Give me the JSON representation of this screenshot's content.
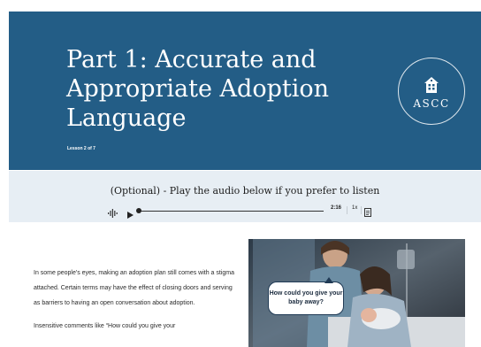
{
  "hero": {
    "title": "Part 1: Accurate and Appropriate Adoption Language",
    "subtitle": "Lesson 2 of 7",
    "logo_text": "ASCC",
    "logo_icon": "house-icon"
  },
  "audio": {
    "title": "(Optional) - Play the audio below if you prefer to listen",
    "duration": "2:16",
    "speed": "1x",
    "icons": [
      "waveform-icon",
      "play-icon",
      "transcript-icon"
    ]
  },
  "content": {
    "paragraph_1": "In some people's eyes, making an adoption plan still comes with a stigma attached. Certain terms may have the effect of closing doors and serving as barriers to having an open conversation about adoption.",
    "paragraph_2": "Insensitive comments like “How could you give your"
  },
  "image": {
    "bubble_text": "How could you give your baby away?"
  }
}
